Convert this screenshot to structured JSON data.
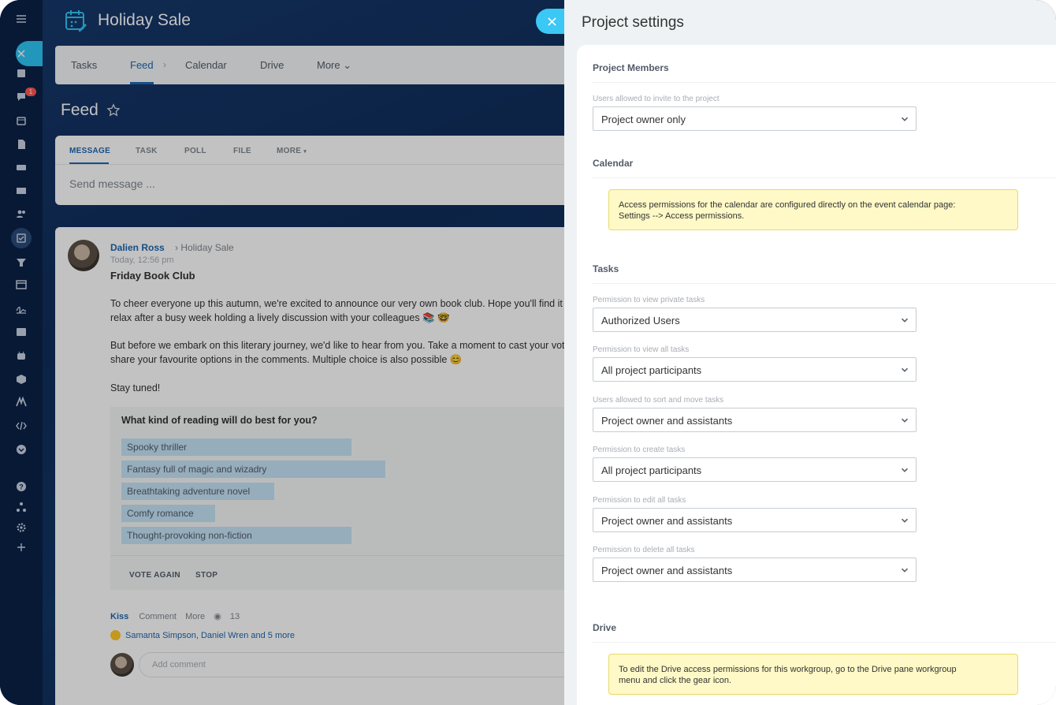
{
  "app": {
    "title": "Holiday Sale",
    "notification_count": "1",
    "tabs": [
      {
        "label": "Tasks"
      },
      {
        "label": "Feed"
      },
      {
        "label": "Calendar"
      },
      {
        "label": "Drive"
      },
      {
        "label": "More"
      }
    ],
    "active_tab": "Feed",
    "feed_title": "Feed",
    "composer": {
      "tabs": [
        {
          "label": "MESSAGE"
        },
        {
          "label": "TASK"
        },
        {
          "label": "POLL"
        },
        {
          "label": "FILE"
        },
        {
          "label": "MORE"
        }
      ],
      "placeholder": "Send message ..."
    }
  },
  "post": {
    "author": "Dalien Ross",
    "destination": "Holiday Sale",
    "date": "Today, 12:56 pm",
    "title": "Friday Book Club",
    "lines": [
      "To cheer everyone up this autumn, we're excited to announce our very own book club. Hope you'll find it a",
      "relax after a busy week holding a lively discussion with your colleagues 📚 🤓",
      "But before we embark on this literary journey, we'd like to hear from you. Take a moment to cast your vote",
      "share your favourite options in the comments. Multiple choice is also possible 😊",
      "Stay tuned!"
    ],
    "poll": {
      "question": "What kind of reading will do best for you?",
      "options": [
        {
          "label": "Spooky thriller",
          "share": 0.54
        },
        {
          "label": "Fantasy full of magic and wizadry",
          "share": 0.62
        },
        {
          "label": "Breathtaking adventure novel",
          "share": 0.36
        },
        {
          "label": "Comfy romance",
          "share": 0.22
        },
        {
          "label": "Thought-provoking non-fiction",
          "share": 0.54
        }
      ],
      "buttons": {
        "vote_again": "VOTE AGAIN",
        "stop": "STOP"
      }
    },
    "actions": {
      "kiss": "Kiss",
      "comment": "Comment",
      "more": "More",
      "views": "13"
    },
    "likes": "Samanta Simpson, Daniel Wren and 5 more",
    "comment_placeholder": "Add comment"
  },
  "settings": {
    "title": "Project settings",
    "members": {
      "heading": "Project Members",
      "invite": {
        "label": "Users allowed to invite to the project",
        "value": "Project owner only"
      }
    },
    "calendar": {
      "heading": "Calendar",
      "note_line1": "Access permissions for the calendar are configured directly on the event calendar page:",
      "note_line2": "Settings --> Access permissions."
    },
    "tasks": {
      "heading": "Tasks",
      "fields": [
        {
          "label": "Permission to view private tasks",
          "value": "Authorized Users"
        },
        {
          "label": "Permission to view all tasks",
          "value": "All project participants"
        },
        {
          "label": "Users allowed to sort and move tasks",
          "value": "Project owner and assistants"
        },
        {
          "label": "Permission to create tasks",
          "value": "All project participants"
        },
        {
          "label": "Permission to edit all tasks",
          "value": "Project owner and assistants"
        },
        {
          "label": "Permission to delete all tasks",
          "value": "Project owner and assistants"
        }
      ]
    },
    "drive": {
      "heading": "Drive",
      "note_line1": "To edit the Drive access permissions for this workgroup, go to the Drive pane workgroup",
      "note_line2": "menu and click the gear icon."
    }
  }
}
